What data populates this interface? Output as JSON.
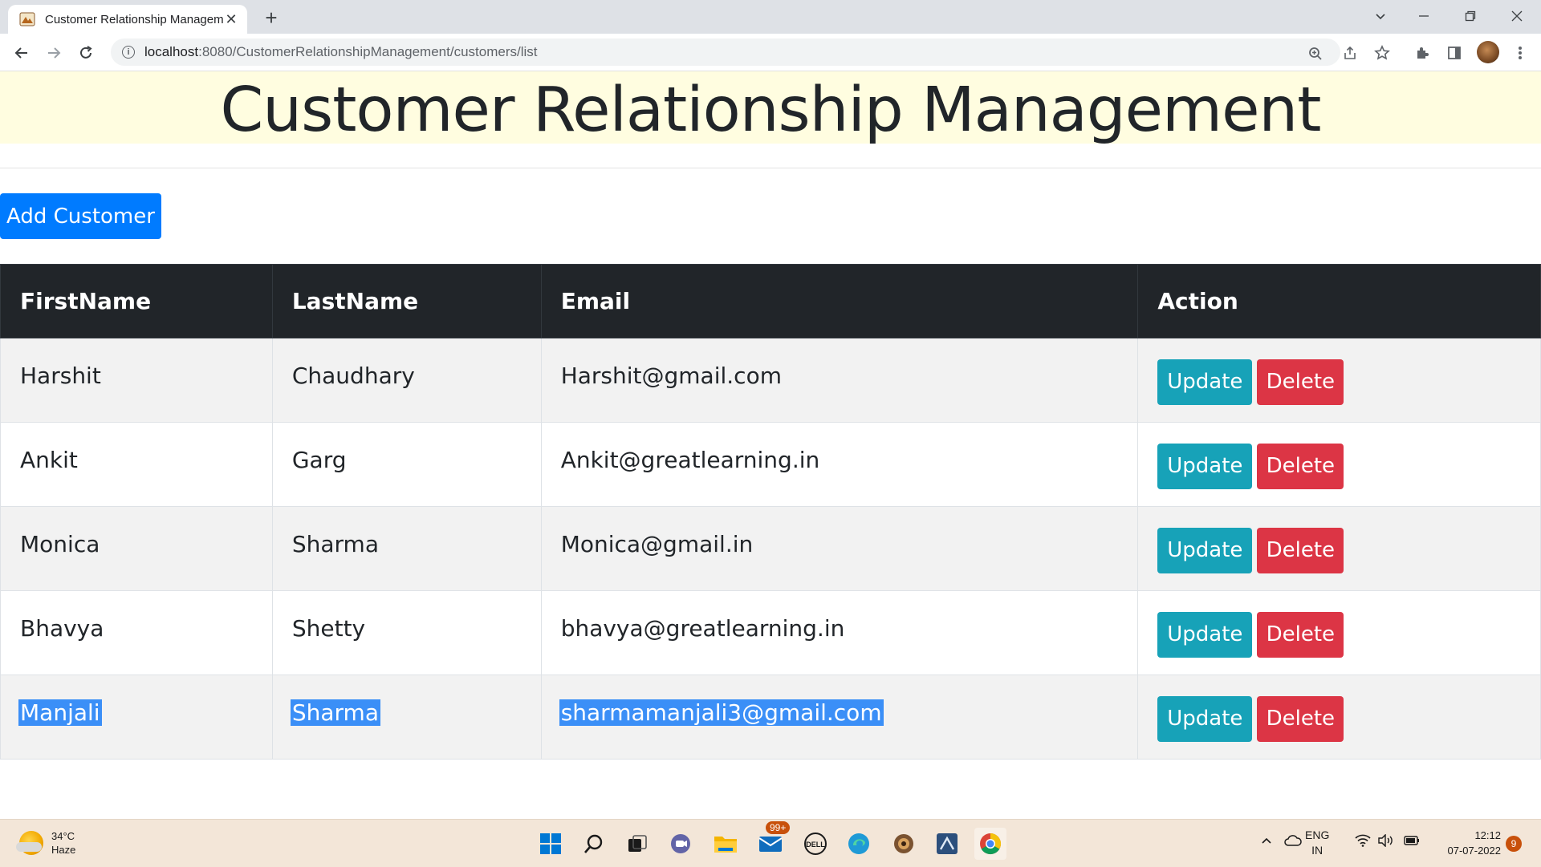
{
  "browser": {
    "tab_title": "Customer Relationship Managem",
    "url_host": "localhost",
    "url_path": ":8080/CustomerRelationshipManagement/customers/list"
  },
  "page": {
    "title": "Customer Relationship Management",
    "add_button": "Add Customer",
    "table": {
      "headers": [
        "FirstName",
        "LastName",
        "Email",
        "Action"
      ],
      "rows": [
        {
          "first": "Harshit",
          "last": "Chaudhary",
          "email": "Harshit@gmail.com",
          "update": "Update",
          "delete": "Delete"
        },
        {
          "first": "Ankit",
          "last": "Garg",
          "email": "Ankit@greatlearning.in",
          "update": "Update",
          "delete": "Delete"
        },
        {
          "first": "Monica",
          "last": "Sharma",
          "email": "Monica@gmail.in",
          "update": "Update",
          "delete": "Delete"
        },
        {
          "first": "Bhavya",
          "last": "Shetty",
          "email": "bhavya@greatlearning.in",
          "update": "Update",
          "delete": "Delete"
        },
        {
          "first": "Manjali",
          "last": "Sharma",
          "email": "sharmamanjali3@gmail.com",
          "update": "Update",
          "delete": "Delete"
        }
      ]
    }
  },
  "taskbar": {
    "weather_temp": "34°C",
    "weather_desc": "Haze",
    "mail_badge": "99+",
    "lang_top": "ENG",
    "lang_bottom": "IN",
    "time": "12:12",
    "date": "07-07-2022",
    "notification_count": "9"
  },
  "colors": {
    "header_band": "#fffde0",
    "primary": "#007bff",
    "update": "#17a2b8",
    "delete": "#dc3545",
    "table_header": "#212529",
    "selection": "#3b8ff7"
  }
}
